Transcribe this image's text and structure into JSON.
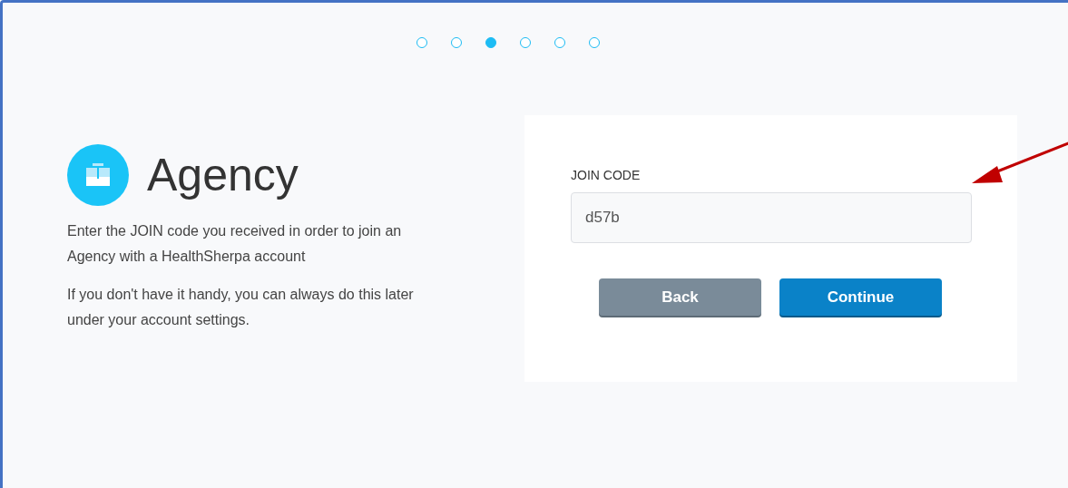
{
  "steps": [
    {
      "selected": false
    },
    {
      "selected": false
    },
    {
      "selected": true
    },
    {
      "selected": false
    },
    {
      "selected": false
    },
    {
      "selected": false
    }
  ],
  "intro": {
    "title": "Agency",
    "paragraphs": [
      "Enter the JOIN code you received in order to join an Agency with a HealthSherpa account",
      "If you don't have it handy, you can always do this later under your account settings."
    ]
  },
  "form": {
    "label": "JOIN CODE",
    "value": "d57b",
    "buttons": [
      {
        "label": "Back",
        "kind": "secondary"
      },
      {
        "label": "Continue",
        "kind": "primary"
      }
    ]
  }
}
